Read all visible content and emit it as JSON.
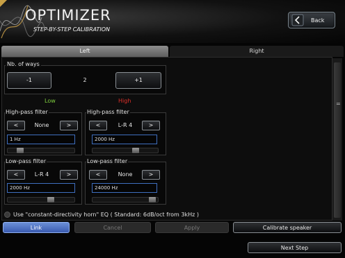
{
  "header": {
    "title": "OPTIMIZER",
    "subtitle": "STEP-BY-STEP CALIBRATION",
    "back_label": "Back"
  },
  "tabs": [
    {
      "label": "Left",
      "active": true
    },
    {
      "label": "Right",
      "active": false
    }
  ],
  "ways": {
    "label": "Nb. of ways",
    "minus_label": "-1",
    "plus_label": "+1",
    "value": "2"
  },
  "bands": {
    "low": {
      "label": "Low",
      "color": "#7fcf3f"
    },
    "high": {
      "label": "High",
      "color": "#e0302a"
    }
  },
  "low": {
    "highpass": {
      "label": "High-pass filter",
      "type": "None",
      "freq": "1 Hz"
    },
    "lowpass": {
      "label": "Low-pass filter",
      "type": "L-R 4",
      "freq": "2000 Hz"
    }
  },
  "high": {
    "highpass": {
      "label": "High-pass filter",
      "type": "L-R 4",
      "freq": "2000 Hz"
    },
    "lowpass": {
      "label": "Low-pass filter",
      "type": "None",
      "freq": "24000 Hz"
    }
  },
  "nav": {
    "prev": "<",
    "next": ">"
  },
  "option": {
    "text": "Use \"constant-directivity horn\" EQ  ( Standard: 6dB/oct from 3kHz )",
    "checked": false
  },
  "buttons": {
    "link": "Link",
    "cancel": "Cancel",
    "apply": "Apply",
    "calibrate": "Calibrate speaker",
    "next_step": "Next Step"
  },
  "colors": {
    "accent": "#4a6fc4",
    "field_border": "#3f6fbf"
  }
}
